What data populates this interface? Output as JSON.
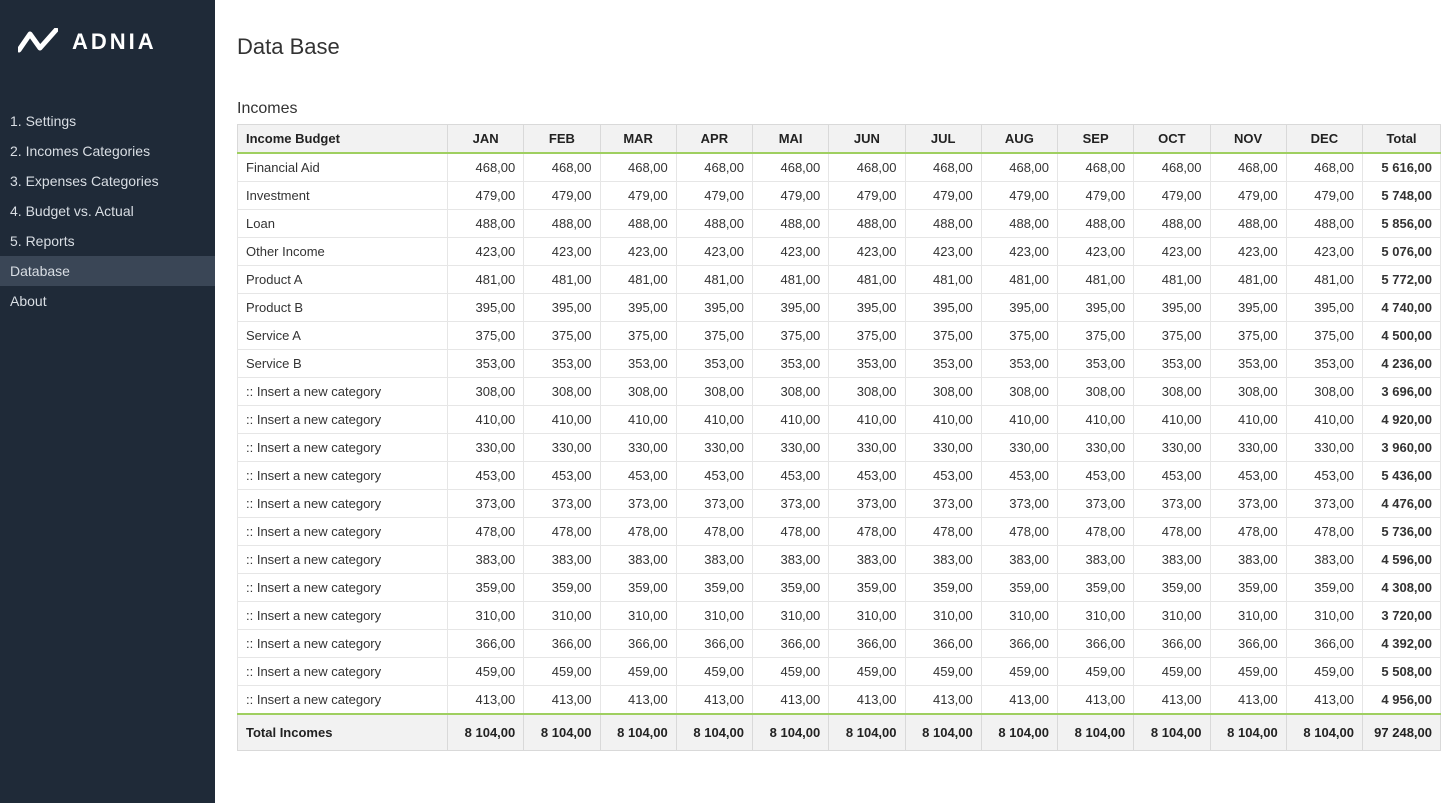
{
  "brand": "ADNIA",
  "page_title": "Data Base",
  "section_title": "Incomes",
  "sidebar": {
    "items": [
      {
        "label": "1. Settings",
        "active": false
      },
      {
        "label": "2. Incomes Categories",
        "active": false
      },
      {
        "label": "3. Expenses Categories",
        "active": false
      },
      {
        "label": "4. Budget vs. Actual",
        "active": false
      },
      {
        "label": "5. Reports",
        "active": false
      },
      {
        "label": "Database",
        "active": true
      },
      {
        "label": "About",
        "active": false
      }
    ]
  },
  "table": {
    "first_header": "Income Budget",
    "months": [
      "JAN",
      "FEB",
      "MAR",
      "APR",
      "MAI",
      "JUN",
      "JUL",
      "AUG",
      "SEP",
      "OCT",
      "NOV",
      "DEC"
    ],
    "total_header": "Total",
    "rows": [
      {
        "name": "Financial Aid",
        "val": "468,00",
        "total": "5 616,00"
      },
      {
        "name": "Investment",
        "val": "479,00",
        "total": "5 748,00"
      },
      {
        "name": "Loan",
        "val": "488,00",
        "total": "5 856,00"
      },
      {
        "name": "Other Income",
        "val": "423,00",
        "total": "5 076,00"
      },
      {
        "name": "Product A",
        "val": "481,00",
        "total": "5 772,00"
      },
      {
        "name": "Product B",
        "val": "395,00",
        "total": "4 740,00"
      },
      {
        "name": "Service A",
        "val": "375,00",
        "total": "4 500,00"
      },
      {
        "name": "Service B",
        "val": "353,00",
        "total": "4 236,00"
      },
      {
        "name": ":: Insert a new category",
        "val": "308,00",
        "total": "3 696,00"
      },
      {
        "name": ":: Insert a new category",
        "val": "410,00",
        "total": "4 920,00"
      },
      {
        "name": ":: Insert a new category",
        "val": "330,00",
        "total": "3 960,00"
      },
      {
        "name": ":: Insert a new category",
        "val": "453,00",
        "total": "5 436,00"
      },
      {
        "name": ":: Insert a new category",
        "val": "373,00",
        "total": "4 476,00"
      },
      {
        "name": ":: Insert a new category",
        "val": "478,00",
        "total": "5 736,00"
      },
      {
        "name": ":: Insert a new category",
        "val": "383,00",
        "total": "4 596,00"
      },
      {
        "name": ":: Insert a new category",
        "val": "359,00",
        "total": "4 308,00"
      },
      {
        "name": ":: Insert a new category",
        "val": "310,00",
        "total": "3 720,00"
      },
      {
        "name": ":: Insert a new category",
        "val": "366,00",
        "total": "4 392,00"
      },
      {
        "name": ":: Insert a new category",
        "val": "459,00",
        "total": "5 508,00"
      },
      {
        "name": ":: Insert a new category",
        "val": "413,00",
        "total": "4 956,00"
      }
    ],
    "footer": {
      "label": "Total Incomes",
      "val": "8 104,00",
      "total": "97 248,00"
    }
  }
}
